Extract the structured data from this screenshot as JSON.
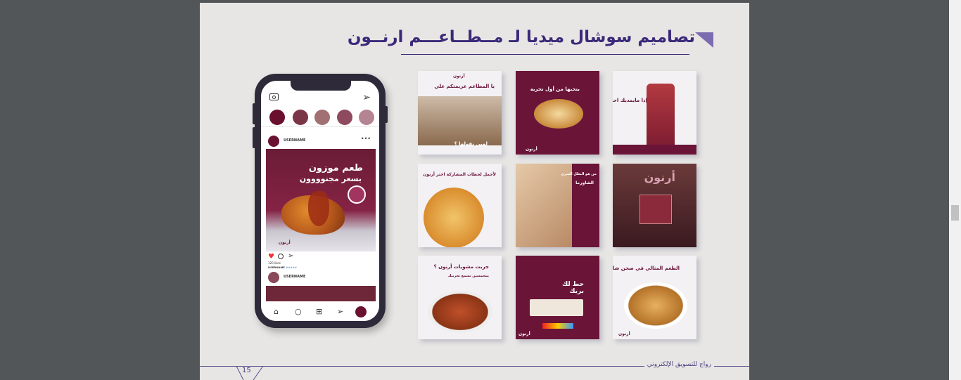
{
  "page": {
    "title": "تصاميم سوشال ميديا لـ مــطــاعـــم ارنــون",
    "page_number": "15",
    "footer_text": "رواج للتسويق الإلكتروني"
  },
  "phone": {
    "post1": {
      "username": "USERNAME",
      "headline1": "طعم موزون",
      "headline2": "بسعر مجنوووون"
    },
    "likes": "120 likes",
    "caption_user": "USERNAME",
    "caption_text": "#####",
    "post2": {
      "username": "USERNAME"
    },
    "logo": "أرنون"
  },
  "grid": [
    {
      "caption": "يا المطاعم عزيمتكم علي",
      "subcaption": "لمين تقولها ؟",
      "colors": [
        "#f3f1f4",
        "#6a1438"
      ]
    },
    {
      "caption": "بتحبها من أول تجربة",
      "colors": [
        "#6a1438",
        "#ffffff"
      ]
    },
    {
      "caption": "إذا مايمديك احنا نجيك",
      "colors": [
        "#f3f1f4",
        "#6a1438"
      ]
    },
    {
      "caption": "لأجمل لحظات المشاركة اختر أرنون",
      "colors": [
        "#f3f1f4",
        "#6a1438"
      ]
    },
    {
      "caption": "من هو البطل السري",
      "subcaption": "الشاورما",
      "colors": [
        "#6a1438",
        "#ffffff"
      ]
    },
    {
      "caption": "أرنون",
      "colors": [
        "#5a2030",
        "#ffffff"
      ]
    },
    {
      "caption": "جربت مشويات أرنون ؟",
      "subcaption": "متحمسين نسمع تجربتك",
      "colors": [
        "#f3f1f4",
        "#6a1438"
      ]
    },
    {
      "caption": "حط لك بريك",
      "colors": [
        "#6a1438",
        "#ffffff"
      ]
    },
    {
      "caption": "الطعم المثالي في صحن شاورما",
      "colors": [
        "#f3f1f4",
        "#6a1438"
      ]
    }
  ],
  "grid_logo": "أرنون"
}
